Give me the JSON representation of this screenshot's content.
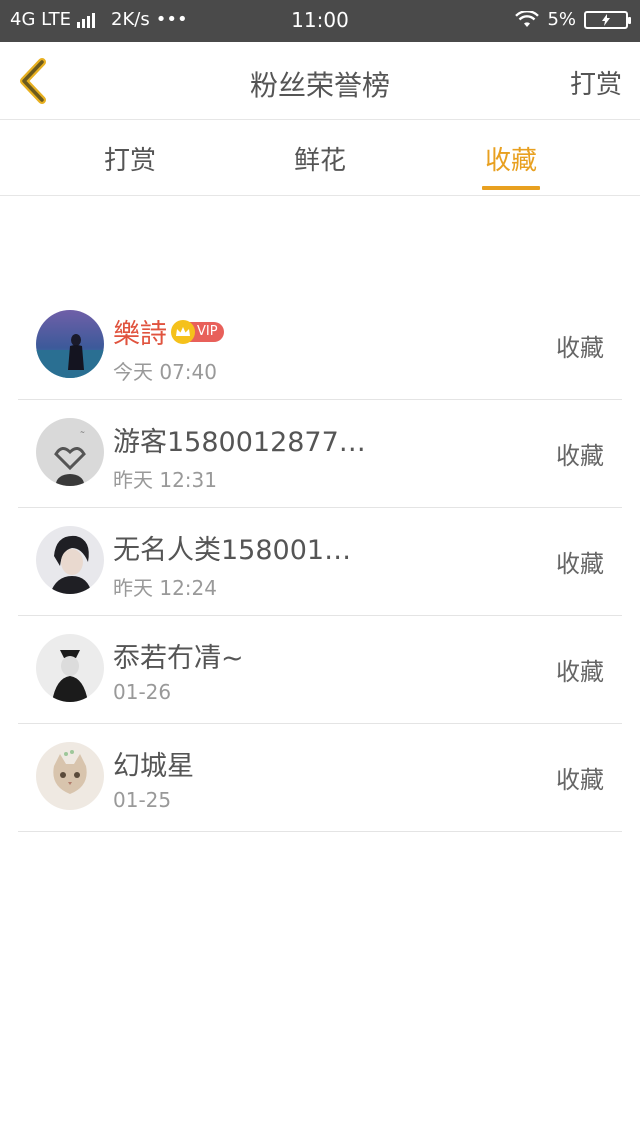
{
  "status_bar": {
    "network": "4G LTE",
    "speed": "2K/s",
    "more": "•••",
    "time": "11:00",
    "battery": "5%"
  },
  "nav": {
    "title": "粉丝荣誉榜",
    "action": "打赏",
    "back_icon": "chevron-left-icon"
  },
  "tabs": [
    {
      "label": "打赏",
      "active": false
    },
    {
      "label": "鲜花",
      "active": false
    },
    {
      "label": "收藏",
      "active": true
    }
  ],
  "accent_color": "#e8a020",
  "vip_name_color": "#e0533e",
  "list": [
    {
      "name": "樂詩",
      "vip": true,
      "vip_label": "VIP",
      "time": "今天 07:40",
      "action": "收藏"
    },
    {
      "name": "游客1580012877…",
      "vip": false,
      "time": "昨天 12:31",
      "action": "收藏"
    },
    {
      "name": "无名人类158001…",
      "vip": false,
      "time": "昨天 12:24",
      "action": "收藏"
    },
    {
      "name": "忝若冇凊~",
      "vip": false,
      "time": "01-26",
      "action": "收藏"
    },
    {
      "name": "幻城星",
      "vip": false,
      "time": "01-25",
      "action": "收藏"
    }
  ]
}
